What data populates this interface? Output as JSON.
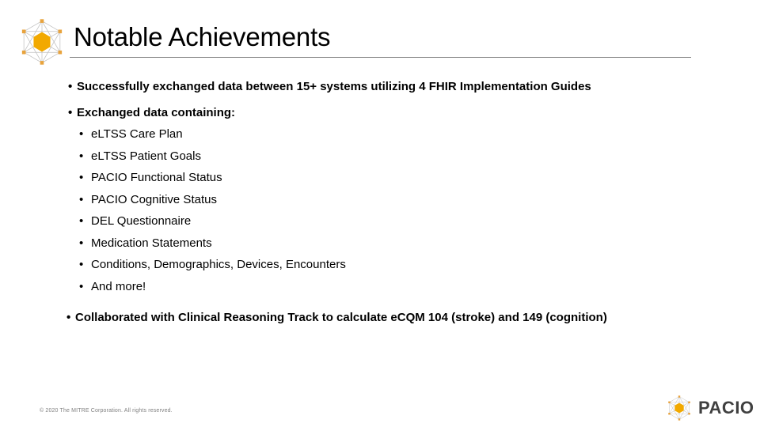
{
  "slide": {
    "title": "Notable Achievements",
    "bullet_marker": "•"
  },
  "achievements": {
    "item1": "Successfully exchanged data between 15+ systems utilizing 4 FHIR Implementation Guides",
    "item2": "Exchanged data containing:",
    "item3": "Collaborated with Clinical Reasoning Track to calculate eCQM 104 (stroke) and 149 (cognition)",
    "sub_items": [
      "eLTSS Care Plan",
      "eLTSS Patient Goals",
      "PACIO Functional Status",
      "PACIO Cognitive Status",
      "DEL Questionnaire",
      "Medication Statements",
      "Conditions, Demographics, Devices, Encounters",
      "And more!"
    ]
  },
  "footer": {
    "copyright": "© 2020 The MITRE Corporation. All rights reserved.",
    "logo_text": "PACIO"
  },
  "colors": {
    "accent_orange": "#F2A900",
    "node_orange": "#E8A33D",
    "graph_gray": "#BFBFBF",
    "rule_gray": "#7F7F7F",
    "footer_gray": "#808080",
    "logo_text_gray": "#404040",
    "text_black": "#000000",
    "background": "#FFFFFF"
  }
}
